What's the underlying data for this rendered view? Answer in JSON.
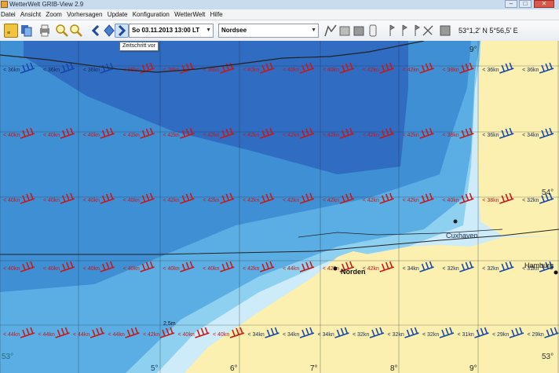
{
  "window": {
    "title": "WetterWelt GRIB-View 2.9",
    "controls": {
      "minimize": "–",
      "maximize": "□",
      "close": "✕"
    }
  },
  "menu": [
    "Datei",
    "Ansicht",
    "Zoom",
    "Vorhersagen",
    "Update",
    "Konfiguration",
    "WetterWelt",
    "Hilfe"
  ],
  "toolbar": {
    "icons": [
      "open-file-icon",
      "files-icon",
      "print-icon",
      "zoom-in-icon",
      "zoom-out-icon",
      "step-back-icon",
      "animation-icon",
      "step-forward-icon"
    ],
    "datetime_value": "So 03.11.2013 13:00 LT",
    "region_value": "Nordsee",
    "tool_icons": [
      "chart-icon",
      "meteogram-icon",
      "layers-icon",
      "tide-icon",
      "marker-icon",
      "pin-a-icon",
      "pin-b-icon",
      "pin-c-icon",
      "measure-icon",
      "grid-icon"
    ],
    "coordinates": "53°1,2' N 5°56,5' E",
    "tooltip": "Zeitschritt vor"
  },
  "map": {
    "colors": {
      "deep": "#2f6cc2",
      "mid": "#3f8fd5",
      "shelf": "#5aaee4",
      "shallow": "#8ed0f0",
      "coast": "#cdebf8",
      "land": "#fbf0b0",
      "barb": "#1747a8",
      "label_red": "#c81818",
      "grid": "#2b2b2b"
    },
    "latitude_labels": [
      "54°",
      "53°",
      "53°"
    ],
    "longitude_labels": [
      "5°",
      "6°",
      "7°",
      "8°",
      "9°",
      "9°"
    ],
    "place_names": [
      "Cuxhaven",
      "Norden",
      "Hamburg"
    ],
    "wind_rows": [
      {
        "lat_index": 0,
        "labels": [
          "< 36kn",
          "< 36kn",
          "< 36kn",
          "< 38kn",
          "< 38kn",
          "< 38kn",
          "< 40kn",
          "< 40kn",
          "< 40kn",
          "< 42kn",
          "< 42kn",
          "< 38kn",
          "< 36kn",
          "< 36kn"
        ]
      },
      {
        "lat_index": 1,
        "labels": [
          "< 40kn",
          "< 40kn",
          "< 40kn",
          "< 42kn",
          "< 42kn",
          "< 42kn",
          "< 42kn",
          "< 42kn",
          "< 42kn",
          "< 42kn",
          "< 42kn",
          "< 38kn",
          "< 36kn",
          "< 34kn"
        ]
      },
      {
        "lat_index": 2,
        "labels": [
          "< 40kn",
          "< 40kn",
          "< 40kn",
          "< 40kn",
          "< 42kn",
          "< 42kn",
          "< 42kn",
          "< 42kn",
          "< 42kn",
          "< 42kn",
          "< 42kn",
          "< 40kn",
          "< 38kn",
          "< 32kn"
        ]
      },
      {
        "lat_index": 3,
        "labels": [
          "< 40kn",
          "< 40kn",
          "< 40kn",
          "< 40kn",
          "< 40kn",
          "< 40kn",
          "< 42kn",
          "< 44kn",
          "< 42kn",
          "< 42kn",
          "< 34kn",
          "< 32kn",
          "< 32kn",
          "< 31kn"
        ]
      },
      {
        "lat_index": 4,
        "labels": [
          "< 44kn",
          "< 44kn",
          "< 44kn",
          "< 44kn",
          "< 42kn",
          "< 40kn",
          "< 40kn",
          "< 34kn",
          "< 34kn",
          "< 34kn",
          "< 32kn",
          "< 32kn",
          "< 32kn",
          "< 31kn",
          "< 29kn",
          "< 29kn"
        ]
      }
    ],
    "wave_label": "2,5m"
  }
}
